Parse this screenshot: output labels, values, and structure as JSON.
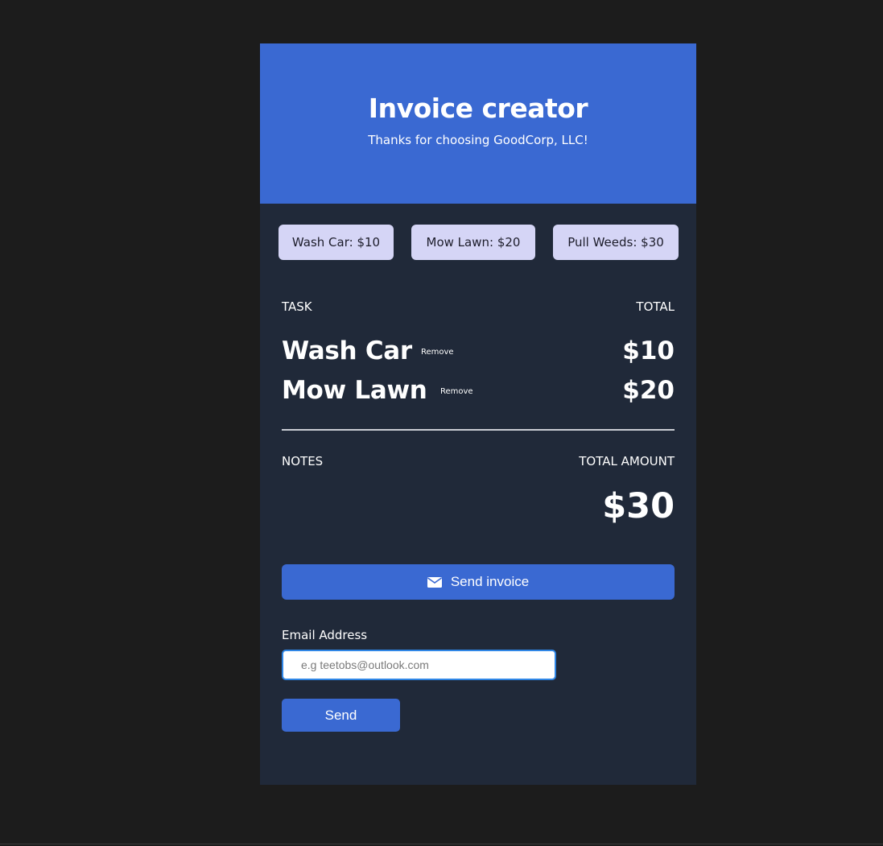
{
  "header": {
    "title": "Invoice creator",
    "subtitle": "Thanks for choosing GoodCorp, LLC!"
  },
  "task_buttons": [
    {
      "label": "Wash Car: $10"
    },
    {
      "label": "Mow Lawn: $20"
    },
    {
      "label": "Pull Weeds: $30"
    }
  ],
  "table": {
    "task_header": "TASK",
    "total_header": "TOTAL",
    "items": [
      {
        "name": "Wash Car",
        "remove_label": "Remove",
        "price": "$10"
      },
      {
        "name": "Mow Lawn",
        "remove_label": "Remove",
        "price": "$20"
      }
    ]
  },
  "summary": {
    "notes_label": "NOTES",
    "total_amount_label": "TOTAL AMOUNT",
    "total_amount": "$30"
  },
  "actions": {
    "send_invoice_label": "Send invoice",
    "send_invoice_icon": "envelope-icon",
    "email_label": "Email Address",
    "email_placeholder": "e.g teetobs@outlook.com",
    "email_value": "",
    "send_label": "Send"
  },
  "colors": {
    "page_background": "#1c1c1c",
    "card_background": "#202939",
    "accent": "#3a69d2",
    "task_button_background": "#d5d5f6",
    "input_focus_border": "#2f86e6"
  }
}
